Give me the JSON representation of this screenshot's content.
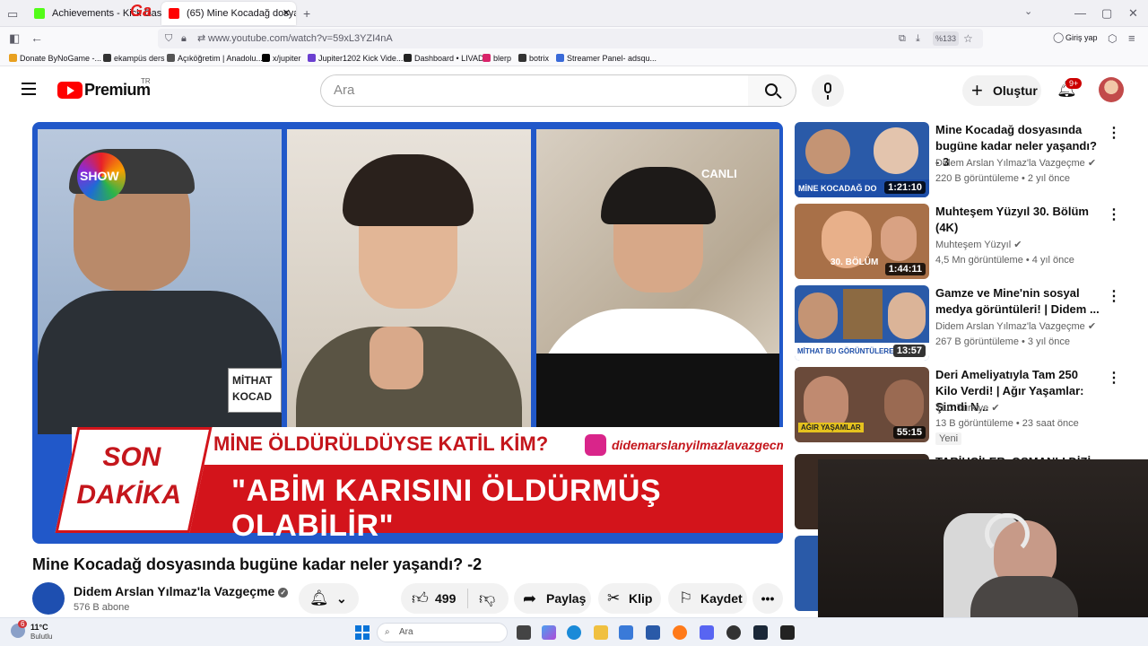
{
  "browser": {
    "tabs": [
      {
        "label": "Achievements - Kick Dashb",
        "color": "#53fc18"
      },
      {
        "label": "(65) Mine Kocadağ dosyası",
        "color": "#ff0000"
      }
    ],
    "url": "www.youtube.com/watch?v=59xL3YZI4nA",
    "zoom": "%133",
    "signin": "Giriş yap",
    "bookmarks": [
      "Donate ByNoGame -...",
      "ekampüs ders",
      "Açıköğretim | Anadolu...",
      "x/jupiter",
      "Jupiter1202 Kick Vide...",
      "Dashboard • LIVAD",
      "blerp",
      "botrix",
      "Streamer Panel- adsqu..."
    ]
  },
  "yt": {
    "logo": "Premium",
    "region": "TR",
    "search_placeholder": "Ara",
    "create_label": "Oluştur",
    "notifications": "9+"
  },
  "video": {
    "title": "Mine Kocadağ dosyasında bugüne kadar neler yaşandı? -2",
    "channel": "Didem Arslan Yılmaz'la Vazgeçme",
    "subscribers": "576 B abone",
    "likes": "499",
    "share": "Paylaş",
    "clip": "Klip",
    "save": "Kaydet",
    "overlay": {
      "show_logo": "SHOW",
      "live": "CANLI",
      "nameplate_line1": "MİTHAT",
      "nameplate_line2": "KOCAD",
      "breaking_1": "SON",
      "breaking_2": "DAKİKA",
      "headline_top": "MİNE ÖLDÜRÜLDÜYSE KATİL KİM?",
      "handle": "didemarslanyilmazlavazgecme",
      "headline_main": "\"ABİM KARISINI ÖLDÜRMÜŞ OLABİLİR\""
    }
  },
  "sidebar": [
    {
      "title": "Mine Kocadağ dosyasında bugüne kadar neler yaşandı? - 3",
      "channel": "Didem Arslan Yılmaz'la Vazgeçme",
      "meta": "220 B görüntüleme • 2 yıl önce",
      "duration": "1:21:10",
      "caption": "MİNE KOCADAĞ DO",
      "thumb_color": "#2a5aa8"
    },
    {
      "title": "Muhteşem Yüzyıl 30. Bölüm (4K)",
      "channel": "Muhteşem Yüzyıl",
      "meta": "4,5 Mn görüntüleme • 4 yıl önce",
      "duration": "1:44:11",
      "caption": "30. BÖLÜM",
      "thumb_color": "#a87048"
    },
    {
      "title": "Gamze ve Mine'nin sosyal medya görüntüleri! | Didem ...",
      "channel": "Didem Arslan Yılmaz'la Vazgeçme",
      "meta": "267 B görüntüleme • 3 yıl önce",
      "duration": "13:57",
      "caption": "MİTHAT BU GÖRÜNTÜLERE",
      "thumb_color": "#2a5aa8"
    },
    {
      "title": "Deri Ameliyatıyla Tam 250 Kilo Verdi! | Ağır Yaşamlar: Şimdi N...",
      "channel": "TLC Turkiye",
      "meta": "13 B görüntüleme • 23 saat önce",
      "badge": "Yeni",
      "duration": "55:15",
      "caption": "AĞIR YAŞAMLAR",
      "thumb_color": "#6a4a3a"
    },
    {
      "title": "TARİHÇİLER, OSMANLI DİZİ...",
      "thumb_color": "#3a2a22"
    }
  ],
  "taskbar": {
    "temp": "11°C",
    "weather": "Bulutlu",
    "weather_badge": "6",
    "search": "Ara"
  },
  "colors": {
    "yt_red": "#ff0000",
    "banner_red": "#d3141b",
    "player_blue": "#2158c9",
    "verified_gray": "#606060"
  }
}
